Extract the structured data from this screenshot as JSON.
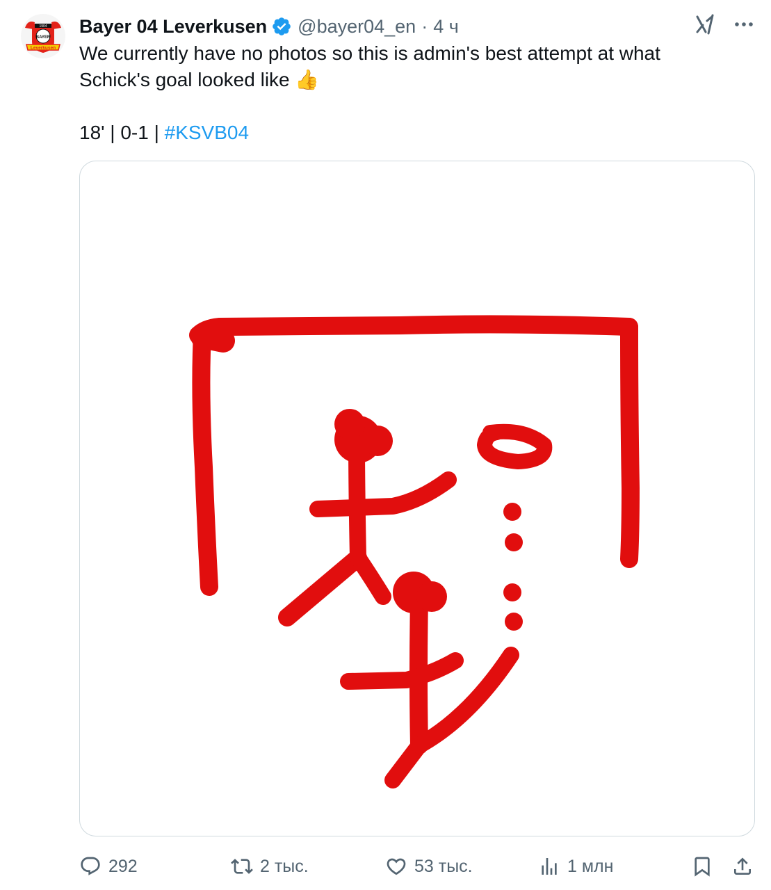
{
  "tweet": {
    "author_name": "Bayer 04 Leverkusen",
    "handle": "@bayer04_en",
    "separator": "·",
    "time": "4 ч",
    "text_line1": "We currently have no photos so this is admin's best attempt at what",
    "text_line2": "Schick's goal looked like 👍",
    "score_prefix": "18' | 0-1 | ",
    "hashtag": "#KSVB04",
    "avatar_text_top": "1904",
    "avatar_text_mid": "BAYER",
    "avatar_text_bottom": "Leverkusen"
  },
  "actions": {
    "replies": "292",
    "retweets": "2 тыс.",
    "likes": "53 тыс.",
    "views": "1 млн"
  },
  "icons": [
    "verified-badge-icon",
    "grok-icon",
    "more-icon",
    "reply-icon",
    "retweet-icon",
    "like-icon",
    "views-icon",
    "bookmark-icon",
    "share-icon"
  ],
  "colors": {
    "accent": "#1d9bf0",
    "text": "#0f1419",
    "secondary": "#536471",
    "drawing_red": "#e10e0e",
    "avatar_red": "#e32219",
    "avatar_yellow": "#f5d000"
  }
}
